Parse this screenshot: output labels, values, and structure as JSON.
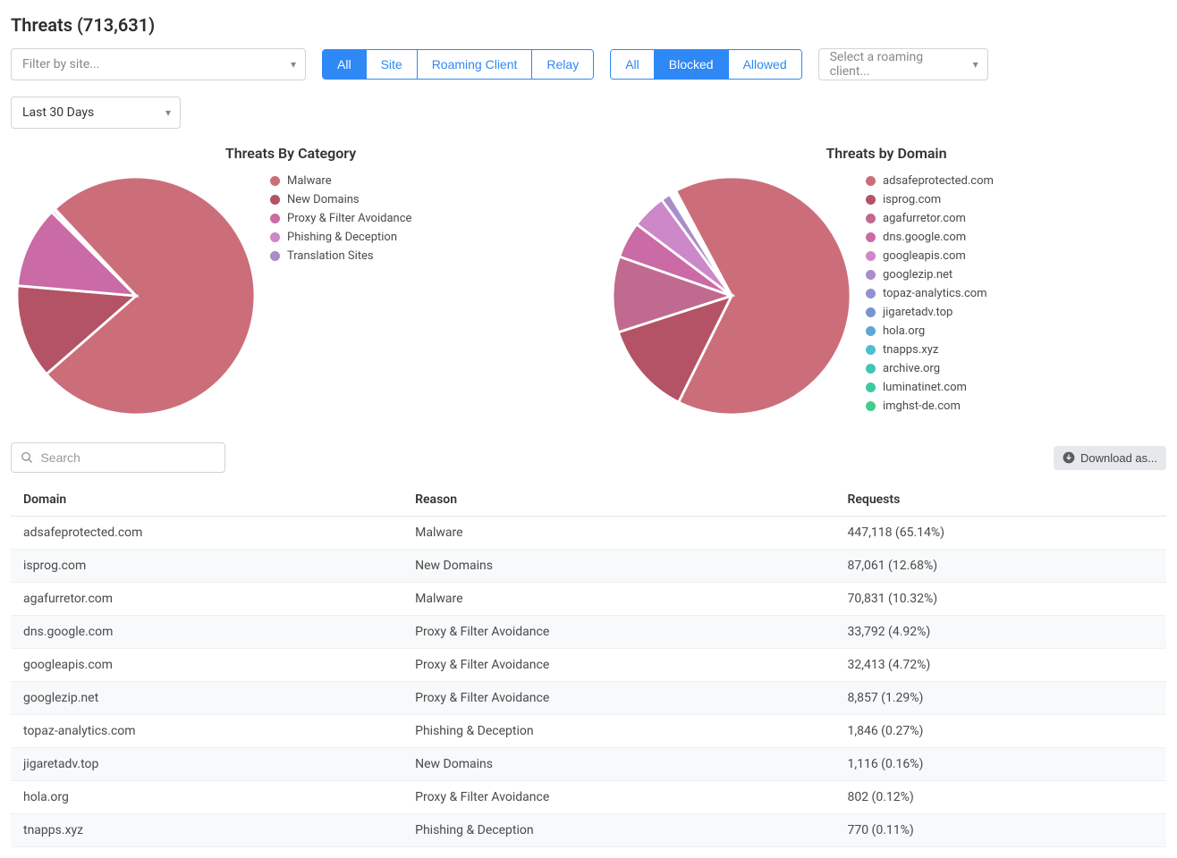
{
  "header": {
    "title": "Threats (713,631)"
  },
  "filters": {
    "site_placeholder": "Filter by site...",
    "source_group": [
      "All",
      "Site",
      "Roaming Client",
      "Relay"
    ],
    "source_active": 0,
    "status_group": [
      "All",
      "Blocked",
      "Allowed"
    ],
    "status_active": 1,
    "roaming_placeholder": "Select a roaming client...",
    "date_value": "Last 30 Days"
  },
  "charts": {
    "category": {
      "title": "Threats By Category",
      "legend": [
        {
          "label": "Malware",
          "color": "#cc6e7a"
        },
        {
          "label": "New Domains",
          "color": "#b45365"
        },
        {
          "label": "Proxy & Filter Avoidance",
          "color": "#ca6ba5"
        },
        {
          "label": "Phishing & Deception",
          "color": "#cc88c8"
        },
        {
          "label": "Translation Sites",
          "color": "#a98dc9"
        }
      ]
    },
    "domain": {
      "title": "Threats by Domain",
      "legend": [
        {
          "label": "adsafeprotected.com",
          "color": "#cc6e7a"
        },
        {
          "label": "isprog.com",
          "color": "#b45365"
        },
        {
          "label": "agafurretor.com",
          "color": "#c16a8f"
        },
        {
          "label": "dns.google.com",
          "color": "#ca6ba5"
        },
        {
          "label": "googleapis.com",
          "color": "#cc88c8"
        },
        {
          "label": "googlezip.net",
          "color": "#a98dc9"
        },
        {
          "label": "topaz-analytics.com",
          "color": "#9292d3"
        },
        {
          "label": "jigaretadv.top",
          "color": "#7a94d1"
        },
        {
          "label": "hola.org",
          "color": "#5fa6d6"
        },
        {
          "label": "tnapps.xyz",
          "color": "#4cc0cf"
        },
        {
          "label": "archive.org",
          "color": "#3fc6b4"
        },
        {
          "label": "luminatinet.com",
          "color": "#3cc9a0"
        },
        {
          "label": "imghst-de.com",
          "color": "#45cc8b"
        }
      ]
    }
  },
  "table_toolbar": {
    "search_placeholder": "Search",
    "download_label": "Download as..."
  },
  "table": {
    "columns": [
      "Domain",
      "Reason",
      "Requests"
    ],
    "rows": [
      {
        "domain": "adsafeprotected.com",
        "reason": "Malware",
        "requests": "447,118 (65.14%)"
      },
      {
        "domain": "isprog.com",
        "reason": "New Domains",
        "requests": "87,061 (12.68%)"
      },
      {
        "domain": "agafurretor.com",
        "reason": "Malware",
        "requests": "70,831 (10.32%)"
      },
      {
        "domain": "dns.google.com",
        "reason": "Proxy & Filter Avoidance",
        "requests": "33,792 (4.92%)"
      },
      {
        "domain": "googleapis.com",
        "reason": "Proxy & Filter Avoidance",
        "requests": "32,413 (4.72%)"
      },
      {
        "domain": "googlezip.net",
        "reason": "Proxy & Filter Avoidance",
        "requests": "8,857 (1.29%)"
      },
      {
        "domain": "topaz-analytics.com",
        "reason": "Phishing & Deception",
        "requests": "1,846 (0.27%)"
      },
      {
        "domain": "jigaretadv.top",
        "reason": "New Domains",
        "requests": "1,116 (0.16%)"
      },
      {
        "domain": "hola.org",
        "reason": "Proxy & Filter Avoidance",
        "requests": "802 (0.12%)"
      },
      {
        "domain": "tnapps.xyz",
        "reason": "Phishing & Deception",
        "requests": "770 (0.11%)"
      }
    ]
  },
  "chart_data": [
    {
      "type": "pie",
      "title": "Threats By Category",
      "series": [
        {
          "name": "Malware",
          "value": 75.5
        },
        {
          "name": "New Domains",
          "value": 12.8
        },
        {
          "name": "Proxy & Filter Avoidance",
          "value": 11.1
        },
        {
          "name": "Phishing & Deception",
          "value": 0.4
        },
        {
          "name": "Translation Sites",
          "value": 0.2
        }
      ]
    },
    {
      "type": "pie",
      "title": "Threats by Domain",
      "series": [
        {
          "name": "adsafeprotected.com",
          "value": 65.14
        },
        {
          "name": "isprog.com",
          "value": 12.68
        },
        {
          "name": "agafurretor.com",
          "value": 10.32
        },
        {
          "name": "dns.google.com",
          "value": 4.92
        },
        {
          "name": "googleapis.com",
          "value": 4.72
        },
        {
          "name": "googlezip.net",
          "value": 1.29
        },
        {
          "name": "topaz-analytics.com",
          "value": 0.27
        },
        {
          "name": "jigaretadv.top",
          "value": 0.16
        },
        {
          "name": "hola.org",
          "value": 0.12
        },
        {
          "name": "tnapps.xyz",
          "value": 0.11
        },
        {
          "name": "archive.org",
          "value": 0.1
        },
        {
          "name": "luminatinet.com",
          "value": 0.09
        },
        {
          "name": "imghst-de.com",
          "value": 0.08
        }
      ]
    }
  ]
}
